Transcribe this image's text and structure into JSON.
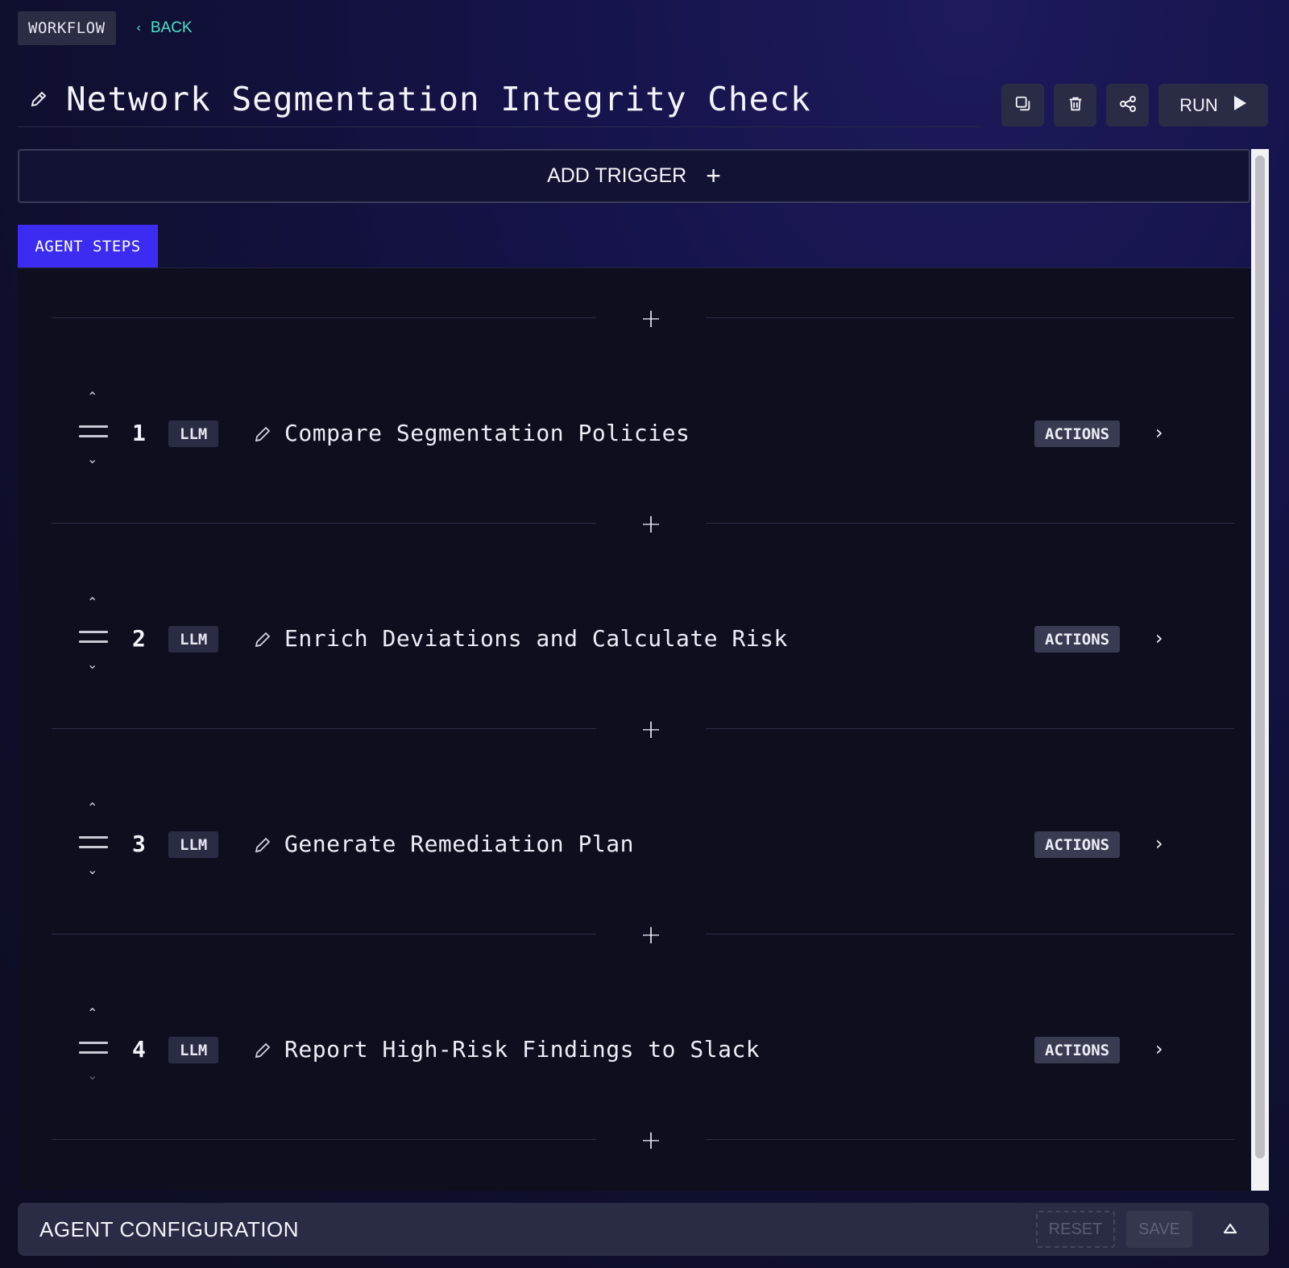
{
  "breadcrumb": {
    "section": "WORKFLOW",
    "back_label": "BACK"
  },
  "workflow": {
    "title": "Network Segmentation Integrity Check"
  },
  "toolbar": {
    "run_label": "RUN",
    "icons": [
      "duplicate-icon",
      "trash-icon",
      "share-icon",
      "play-icon"
    ]
  },
  "trigger": {
    "add_label": "ADD TRIGGER",
    "plus": "+"
  },
  "tabs": [
    {
      "label": "AGENT STEPS",
      "active": true
    }
  ],
  "steps": [
    {
      "number": "1",
      "type": "LLM",
      "name": "Compare Segmentation Policies",
      "actions_label": "ACTIONS"
    },
    {
      "number": "2",
      "type": "LLM",
      "name": "Enrich Deviations and Calculate Risk",
      "actions_label": "ACTIONS"
    },
    {
      "number": "3",
      "type": "LLM",
      "name": "Generate Remediation Plan",
      "actions_label": "ACTIONS"
    },
    {
      "number": "4",
      "type": "LLM",
      "name": "Report High-Risk Findings to Slack",
      "actions_label": "ACTIONS"
    }
  ],
  "add_step_symbol": "+",
  "config": {
    "title": "AGENT CONFIGURATION",
    "reset_label": "RESET",
    "save_label": "SAVE"
  },
  "colors": {
    "accent": "#3c2cf2",
    "link": "#4fe3c6",
    "panel": "#0d0f1f",
    "button": "#2a2c45"
  }
}
